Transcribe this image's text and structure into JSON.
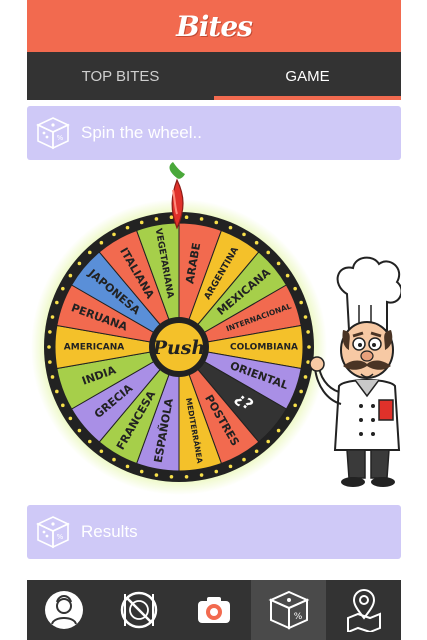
{
  "app": {
    "logo": "Bites"
  },
  "tabs": [
    {
      "label": "TOP BITES",
      "active": false
    },
    {
      "label": "GAME",
      "active": true
    }
  ],
  "spin_panel": {
    "label": "Spin the wheel.."
  },
  "wheel": {
    "center_label": "Push",
    "segments": [
      {
        "label": "ARABE",
        "color": "#f26a4f"
      },
      {
        "label": "ARGENTINA",
        "color": "#f4c12a"
      },
      {
        "label": "MEXICANA",
        "color": "#a6cf4a"
      },
      {
        "label": "INTERNACIONAL",
        "color": "#f26a4f"
      },
      {
        "label": "COLOMBIANA",
        "color": "#f4c12a"
      },
      {
        "label": "ORIENTAL",
        "color": "#a98fe6"
      },
      {
        "label": "¿?",
        "color": "#333333"
      },
      {
        "label": "POSTRES",
        "color": "#f26a4f"
      },
      {
        "label": "MEDITERRÁNEA",
        "color": "#f4c12a"
      },
      {
        "label": "ESPAÑOLA",
        "color": "#a98fe6"
      },
      {
        "label": "FRANCESA",
        "color": "#a6cf4a"
      },
      {
        "label": "GRECIA",
        "color": "#a98fe6"
      },
      {
        "label": "INDIA",
        "color": "#a6cf4a"
      },
      {
        "label": "AMERICANA",
        "color": "#f4c12a"
      },
      {
        "label": "PERUANA",
        "color": "#f26a4f"
      },
      {
        "label": "JAPONESA",
        "color": "#5a8fd8"
      },
      {
        "label": "ITALIANA",
        "color": "#f26a4f"
      },
      {
        "label": "VEGETARIANA",
        "color": "#a6cf4a"
      }
    ]
  },
  "results_panel": {
    "label": "Results"
  },
  "bottom_nav": [
    {
      "icon": "profile-icon",
      "active": false
    },
    {
      "icon": "no-food-icon",
      "active": false
    },
    {
      "icon": "camera-icon",
      "active": false
    },
    {
      "icon": "dice-icon",
      "active": true
    },
    {
      "icon": "map-pin-icon",
      "active": false
    }
  ],
  "colors": {
    "accent": "#f26a4f",
    "dark": "#333333",
    "panel": "#cfc9f7"
  }
}
